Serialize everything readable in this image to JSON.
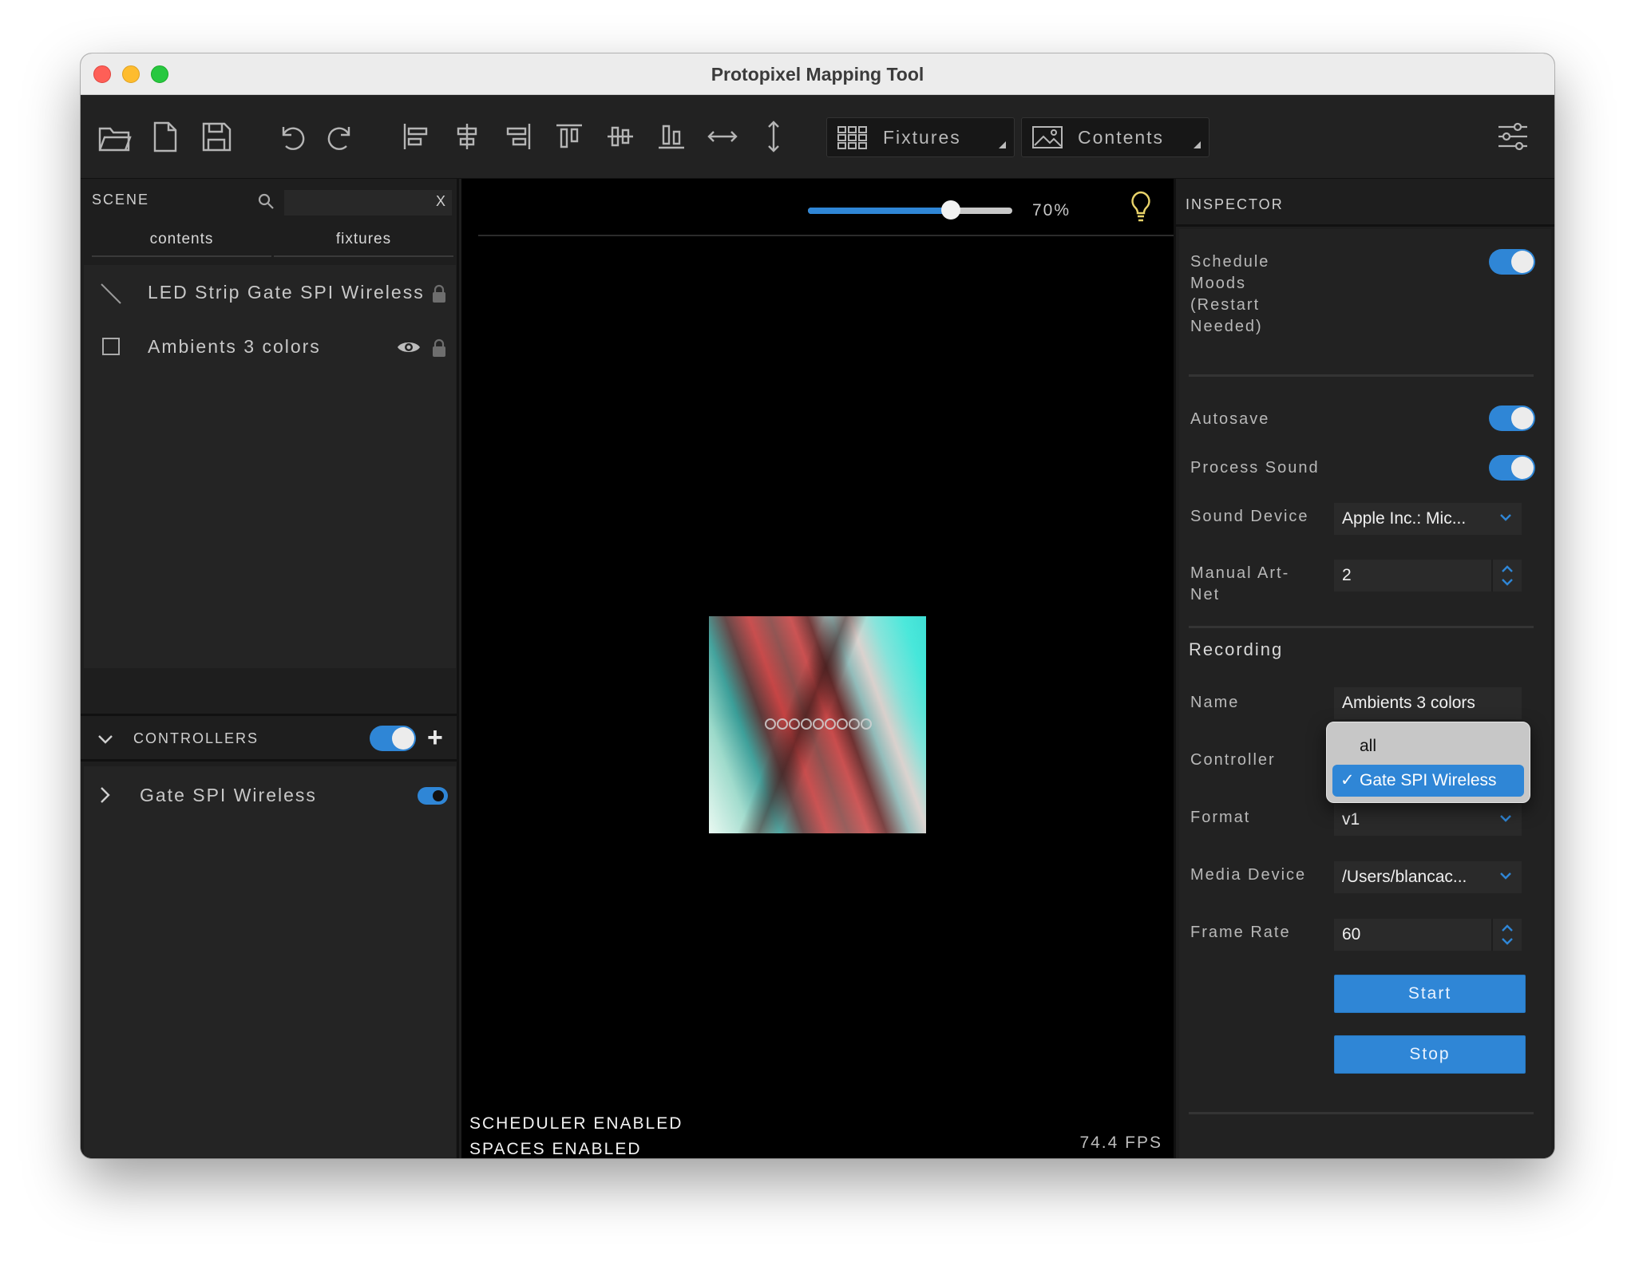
{
  "window": {
    "title": "Protopixel Mapping Tool"
  },
  "toolbar": {
    "fixtures_label": "Fixtures",
    "contents_label": "Contents"
  },
  "scene": {
    "header": "SCENE",
    "search_clear": "X",
    "tabs": [
      "contents",
      "fixtures"
    ],
    "items": [
      {
        "name": "LED Strip Gate SPI Wireless",
        "icon": "line-icon",
        "visible_icon": false,
        "locked": true
      },
      {
        "name": "Ambients 3 colors",
        "icon": "square-icon",
        "visible_icon": true,
        "locked": true
      }
    ]
  },
  "controllers": {
    "header": "CONTROLLERS",
    "enabled": true,
    "add_label": "+",
    "items": [
      {
        "name": "Gate SPI Wireless",
        "enabled": true
      }
    ]
  },
  "canvas": {
    "zoom_percent": 70,
    "zoom_label": "70%",
    "status_lines": [
      "SCHEDULER ENABLED",
      "SPACES ENABLED"
    ],
    "fps": "74.4 FPS"
  },
  "inspector": {
    "header": "INSPECTOR",
    "schedule_moods_label": "Schedule Moods (Restart Needed)",
    "schedule_moods_on": true,
    "autosave_label": "Autosave",
    "autosave_on": true,
    "process_sound_label": "Process Sound",
    "process_sound_on": true,
    "sound_device_label": "Sound Device",
    "sound_device_value": "Apple Inc.: Mic...",
    "manual_artnet_label": "Manual Art-Net",
    "manual_artnet_value": "2",
    "recording": {
      "title": "Recording",
      "name_label": "Name",
      "name_value": "Ambients 3 colors",
      "controller_label": "Controller",
      "format_label": "Format",
      "format_value": "v1",
      "media_device_label": "Media Device",
      "media_device_value": "/Users/blancac...",
      "frame_rate_label": "Frame Rate",
      "frame_rate_value": "60",
      "start_label": "Start",
      "stop_label": "Stop"
    }
  },
  "controller_popup": {
    "options": [
      "all",
      "Gate SPI Wireless"
    ],
    "selected": "Gate SPI Wireless",
    "check": "✓"
  },
  "colors": {
    "accent": "#2f86d6",
    "panel": "#1e1e1e",
    "canvas": "#000000"
  }
}
